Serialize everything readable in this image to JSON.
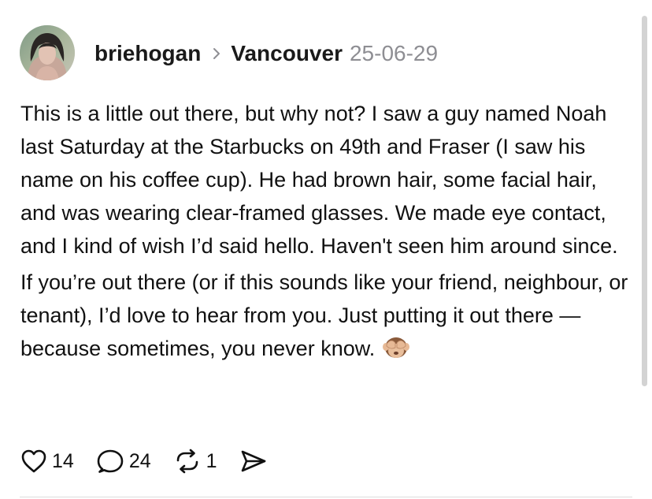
{
  "post": {
    "author": {
      "username": "briehogan",
      "avatar_icon": "profile-photo"
    },
    "community": "Vancouver",
    "date": "25-06-29",
    "paragraphs": [
      "This is a little out there, but why not? I saw a guy named Noah last Saturday at the Starbucks on 49th and Fraser (I saw his name on his coffee cup). He had brown hair, some facial hair, and was wearing clear-framed glasses. We made eye contact, and I kind of wish I’d said hello. Haven't seen him around since.",
      "If you’re out there (or if this sounds like your friend, neighbour, or tenant), I’d love to hear from you. Just putting it out there — because sometimes, you never know."
    ],
    "emoji_icon": "see-no-evil-monkey",
    "actions": {
      "likes": "14",
      "comments": "24",
      "reposts": "1"
    }
  },
  "colors": {
    "text": "#111111",
    "muted": "#8e8e93",
    "divider": "#dcdcdc"
  }
}
